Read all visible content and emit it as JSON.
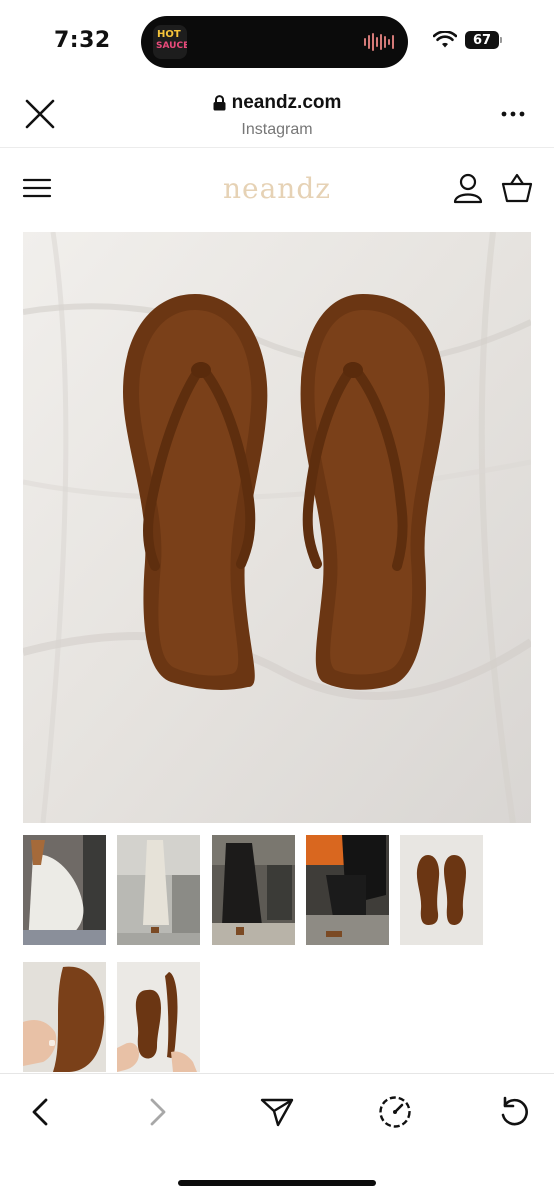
{
  "status_bar": {
    "time": "7:32",
    "island_app_line1": "HOT",
    "island_app_line2": "SAUCE",
    "battery": "67"
  },
  "browser": {
    "domain": "neandz.com",
    "source_label": "Instagram"
  },
  "site": {
    "logo": "neandz",
    "logo_color": "#e6d2b5"
  },
  "product": {
    "main_image": "brown-suede-flip-flops",
    "thumbnails": [
      "model-in-white-skirt-with-sandals",
      "model-in-long-skirt-standing",
      "model-in-black-dress-outdoor",
      "model-seated-with-orange-bag",
      "flip-flops-on-white-sheet",
      "hand-holding-sandal-sole",
      "hand-holding-sandal-side"
    ]
  },
  "icons": {
    "close": "close-icon",
    "lock": "lock-icon",
    "more": "more-dots-icon",
    "menu": "hamburger-menu-icon",
    "account": "account-icon",
    "cart": "shopping-basket-icon",
    "back": "chevron-left-icon",
    "forward": "chevron-right-icon",
    "share": "send-icon",
    "browser": "compass-icon",
    "reload": "reload-icon"
  }
}
